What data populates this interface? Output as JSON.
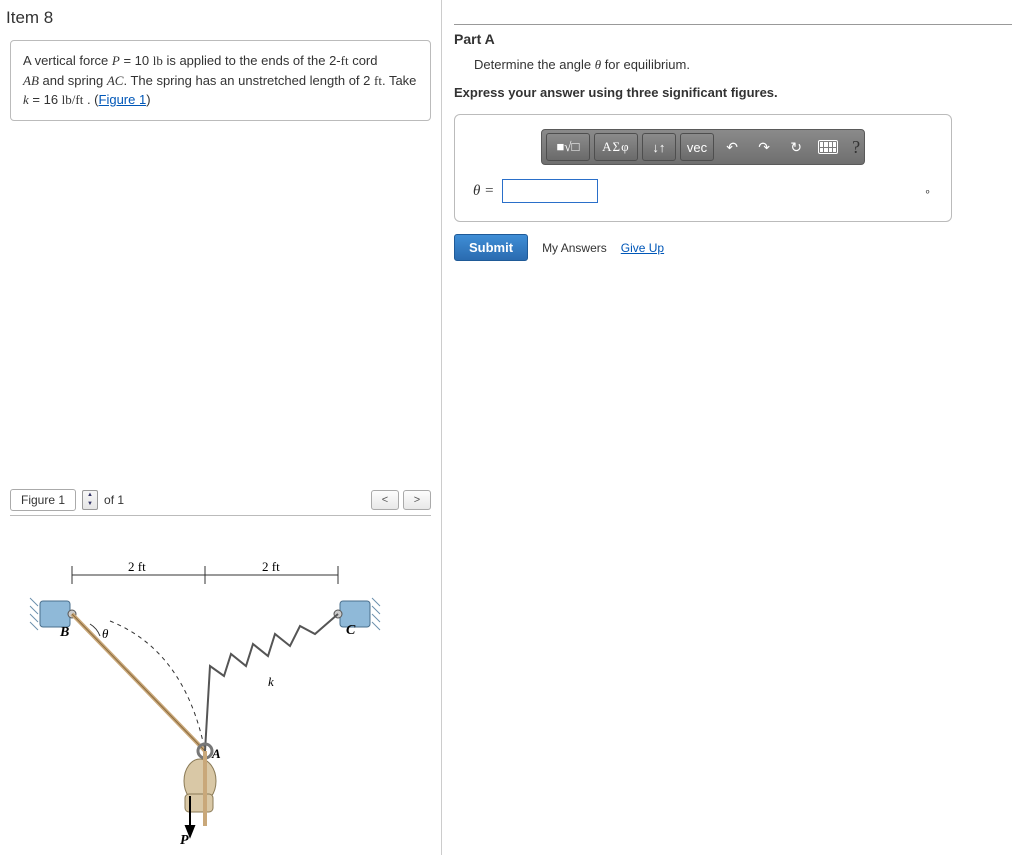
{
  "item_title": "Item 8",
  "problem": {
    "p1_a": "A vertical force ",
    "p_var": "P",
    "p1_b": " = 10 ",
    "lb": "lb",
    "p1_c": " is applied to the ends of the 2-",
    "ft": "ft",
    "p1_d": " cord ",
    "ab": "AB",
    "p2_a": " and spring ",
    "ac": "AC",
    "p2_b": ". The spring has an unstretched length of 2 ",
    "p2_c": ". Take ",
    "k_var": "k",
    "p2_d": " = 16  ",
    "lbft": "lb/ft",
    "p2_e": " . (",
    "fig_link": "Figure 1",
    "p2_f": ")"
  },
  "figure": {
    "tab_label": "Figure 1",
    "of_label": "of 1",
    "prev": "<",
    "next": ">",
    "dim1": "2 ft",
    "dim2": "2 ft",
    "labelB": "B",
    "labelC": "C",
    "labelA": "A",
    "labelP": "P",
    "labelk": "k",
    "theta": "θ"
  },
  "partA": {
    "title": "Part A",
    "instruction_a": "Determine the angle ",
    "theta": "θ",
    "instruction_b": " for equilibrium.",
    "express": "Express your answer using three significant figures.",
    "toolbar": {
      "template": "■√□",
      "sigma": "ΑΣφ",
      "subsup": "↓↑",
      "vec": "vec",
      "undo": "↶",
      "redo": "↷",
      "reset": "↻",
      "help": "?"
    },
    "theta_eq": "θ =",
    "answer_value": "",
    "unit": "∘",
    "submit": "Submit",
    "my_answers": "My Answers",
    "giveup": "Give Up"
  }
}
